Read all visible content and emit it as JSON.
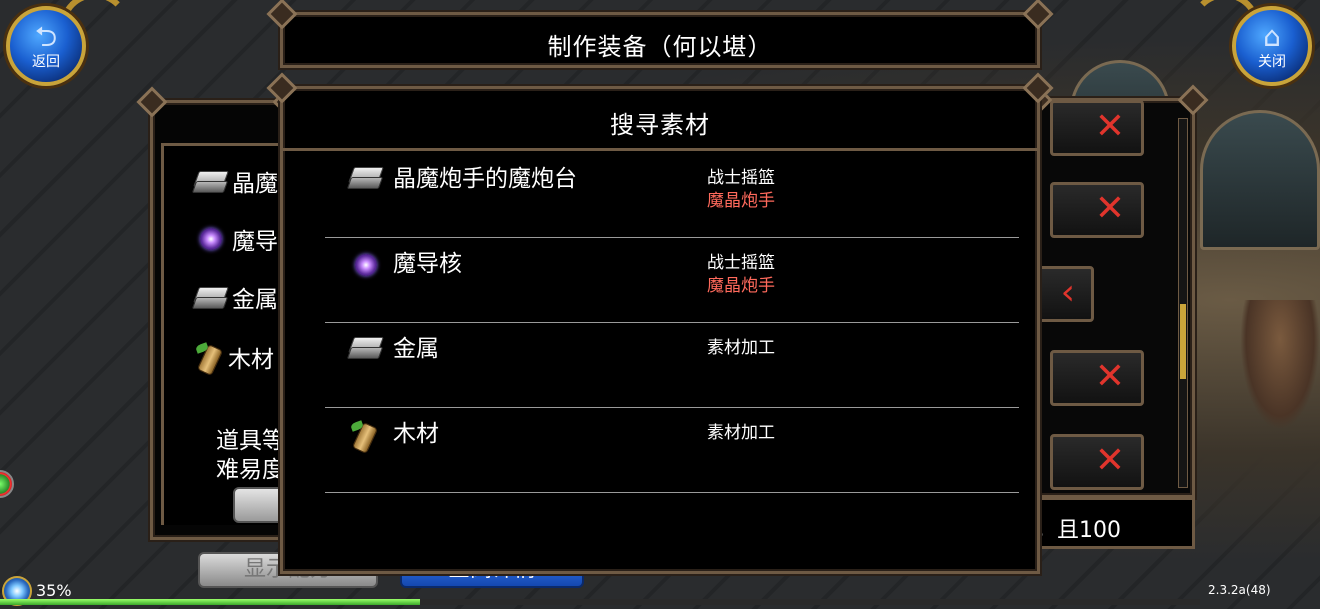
{
  "title": "制作装备（何以堪）",
  "nav": {
    "back_label": "返回",
    "close_label": "关闭"
  },
  "left_panel": {
    "materials": [
      {
        "label": "晶魔",
        "icon": "ingot-icon"
      },
      {
        "label": "魔导",
        "icon": "magic-core-icon"
      },
      {
        "label": "金属",
        "icon": "ingot-icon"
      },
      {
        "label": "木材",
        "icon": "wood-icon"
      }
    ],
    "desc_line1": "道具等",
    "desc_line2": "难易度"
  },
  "right_panel": {
    "bottom_text": "，且100"
  },
  "dialog": {
    "title": "搜寻素材",
    "results": [
      {
        "name": "晶魔炮手的魔炮台",
        "icon": "ingot-icon",
        "source": "战士摇篮",
        "source_sub": "魔晶炮手"
      },
      {
        "name": "魔导核",
        "icon": "magic-core-icon",
        "source": "战士摇篮",
        "source_sub": "魔晶炮手"
      },
      {
        "name": "金属",
        "icon": "ingot-icon",
        "source": "素材加工",
        "source_sub": ""
      },
      {
        "name": "木材",
        "icon": "wood-icon",
        "source": "素材加工",
        "source_sub": ""
      }
    ]
  },
  "bottom_buttons": {
    "show_recipe": "显示配方",
    "view_detail": "查阅详情"
  },
  "status": {
    "progress_percent": 35,
    "progress_label": "35%",
    "version": "2.3.2a(48)"
  },
  "colors": {
    "frame_bronze": "#6e5a44",
    "source_red": "#ff6a5c",
    "close_x_red": "#e0342c",
    "nav_blue": "#1a5fd0",
    "gold": "#c9a43a"
  }
}
